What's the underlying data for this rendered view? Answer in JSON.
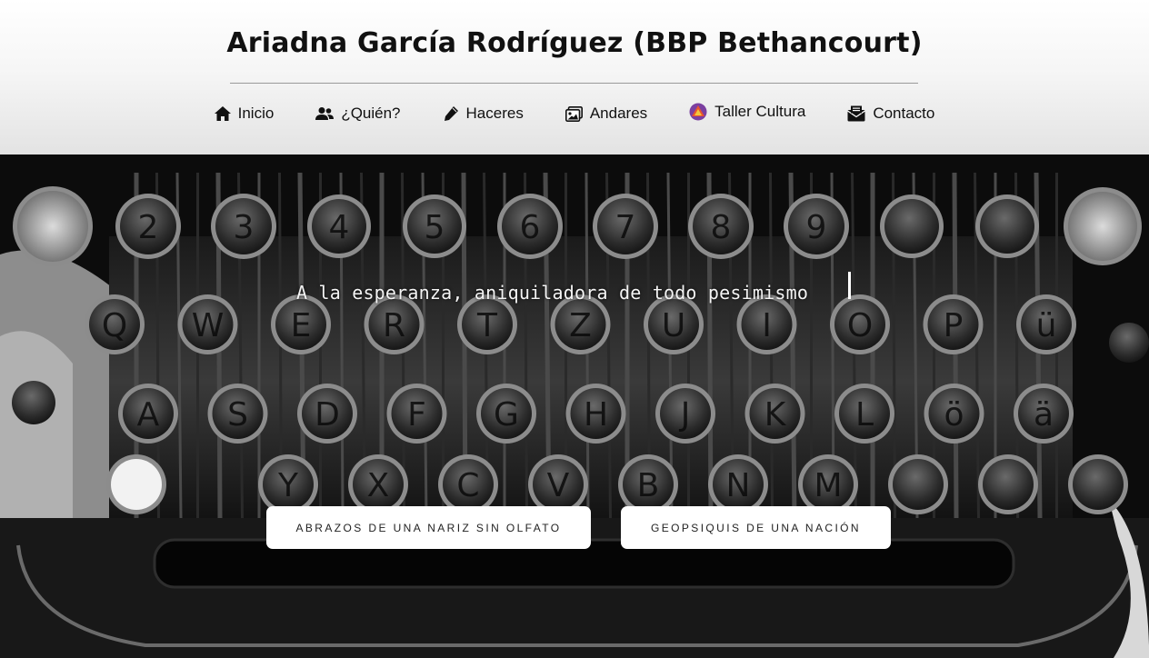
{
  "header": {
    "title": "Ariadna García Rodríguez (BBP Bethancourt)"
  },
  "nav": {
    "items": [
      {
        "label": "Inicio",
        "icon": "home-icon"
      },
      {
        "label": "¿Quién?",
        "icon": "users-icon"
      },
      {
        "label": "Haceres",
        "icon": "pen-icon"
      },
      {
        "label": "Andares",
        "icon": "images-icon"
      },
      {
        "label": "Taller Cultura",
        "icon": "cultura-logo-icon"
      },
      {
        "label": "Contacto",
        "icon": "envelope-icon"
      }
    ]
  },
  "hero": {
    "quote": "A la esperanza, aniquiladora de todo pesimismo",
    "buttons": [
      {
        "label": "ABRAZOS DE UNA NARIZ SIN OLFATO"
      },
      {
        "label": "GEOPSIQUIS DE UNA NACIÓN"
      }
    ],
    "keys": {
      "row1": [
        "",
        "2",
        "3",
        "4",
        "5",
        "6",
        "7",
        "8",
        "9",
        "",
        "",
        ""
      ],
      "row2": [
        "Q",
        "W",
        "E",
        "R",
        "T",
        "Z",
        "U",
        "I",
        "O",
        "P",
        "ü"
      ],
      "row3": [
        "A",
        "S",
        "D",
        "F",
        "G",
        "H",
        "J",
        "K",
        "L",
        "ö",
        "ä"
      ],
      "row4": [
        "",
        "Y",
        "X",
        "C",
        "V",
        "B",
        "N",
        "M",
        "",
        "",
        "",
        ""
      ]
    }
  },
  "colors": {
    "header_bg": "#f3f3f3",
    "hero_bg": "#0b0b0b",
    "button_bg": "#ffffff",
    "cultura_logo": [
      "#e8542f",
      "#7b3fa0",
      "#f2c53d"
    ]
  }
}
